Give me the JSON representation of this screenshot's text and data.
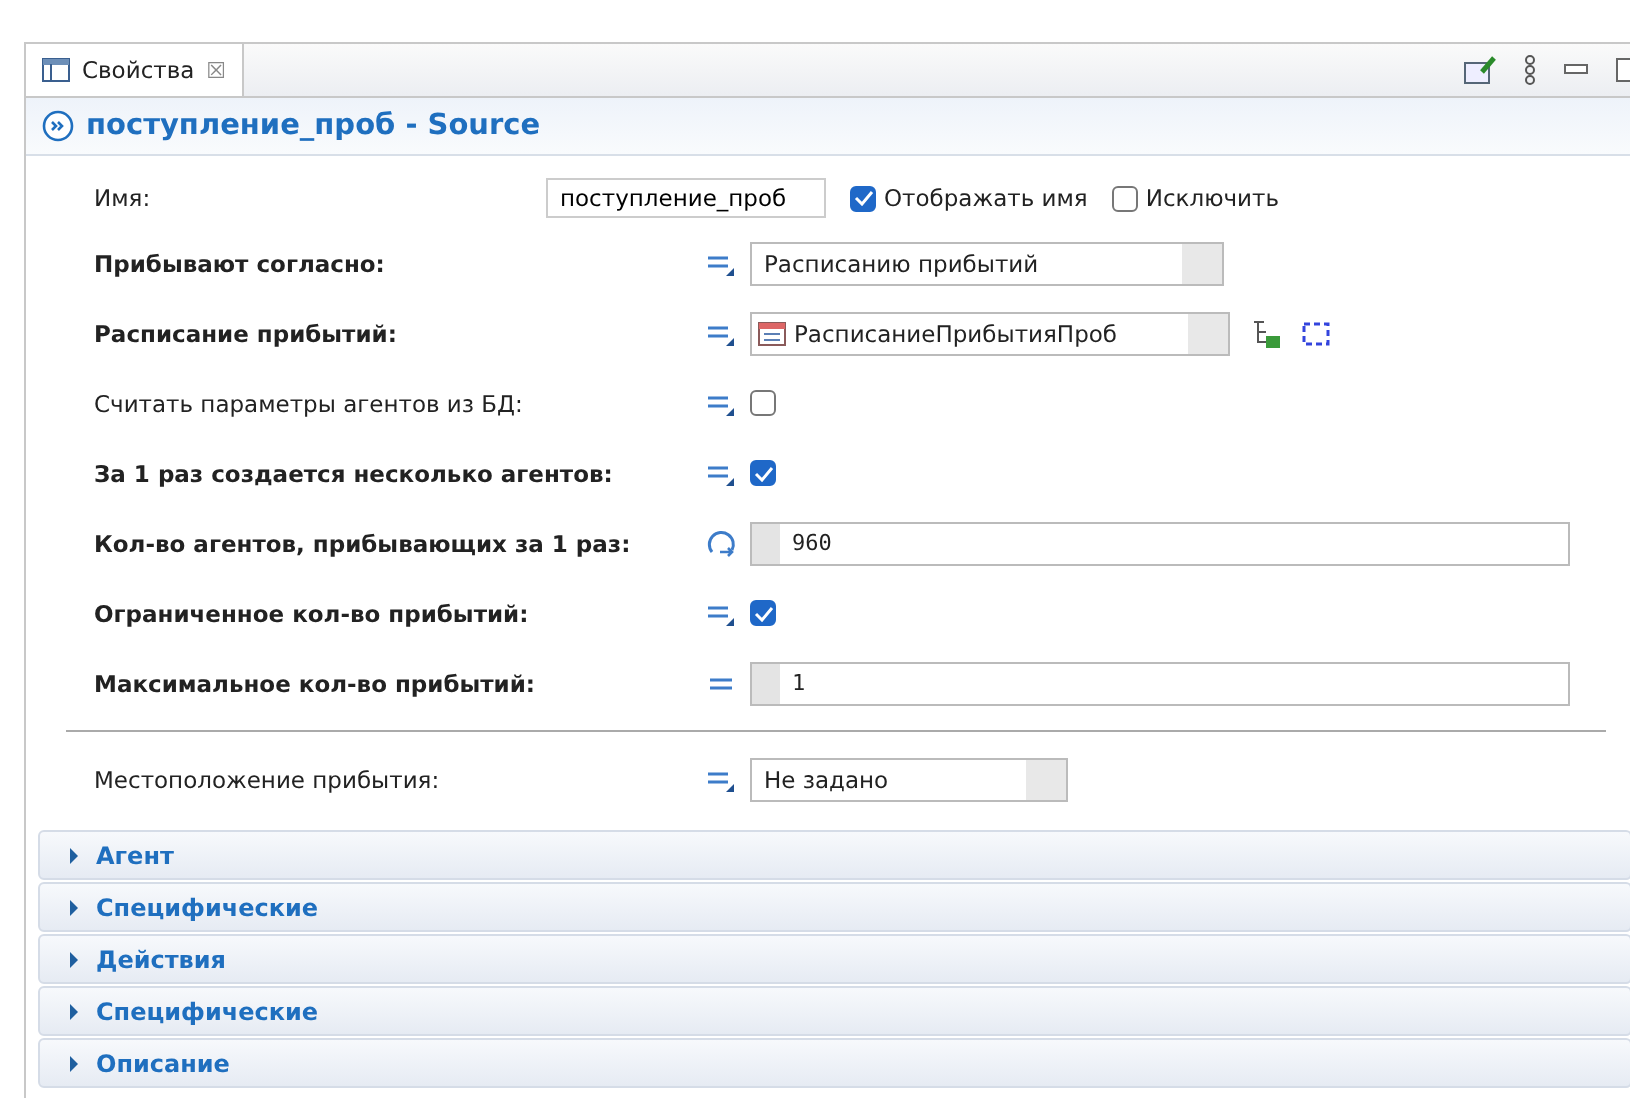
{
  "tab": {
    "label": "Свойства",
    "close": "☒"
  },
  "header": {
    "title": "поступление_проб - Source"
  },
  "name_row": {
    "label": "Имя:",
    "value": "поступление_проб",
    "options": [
      {
        "label": "Отображать имя",
        "checked": true
      },
      {
        "label": "Исключить",
        "checked": false
      }
    ]
  },
  "rows": [
    {
      "kind": "dropdown",
      "label": "Прибывают согласно:",
      "bold": true,
      "editor": {
        "kind": "static"
      },
      "value": "Расписанию прибытий"
    },
    {
      "kind": "reference",
      "label": "Расписание прибытий:",
      "bold": true,
      "editor": {
        "kind": "static"
      },
      "value": "РасписаниеПрибытияПроб"
    },
    {
      "kind": "checkbox",
      "label": "Считать параметры агентов из БД:",
      "bold": false,
      "editor": {
        "kind": "static"
      },
      "checked": false
    },
    {
      "kind": "checkbox",
      "label": "За 1 раз создается несколько агентов:",
      "bold": true,
      "editor": {
        "kind": "static"
      },
      "checked": true
    },
    {
      "kind": "code",
      "label": "Кол-во агентов, прибывающих за 1 раз:",
      "bold": true,
      "editor": {
        "kind": "dynamic"
      },
      "value": "960"
    },
    {
      "kind": "checkbox",
      "label": "Ограниченное кол-во прибытий:",
      "bold": true,
      "editor": {
        "kind": "static"
      },
      "checked": true
    },
    {
      "kind": "code",
      "label": "Максимальное кол-во прибытий:",
      "bold": true,
      "editor": {
        "kind": "plain"
      },
      "value": "1"
    },
    {
      "kind": "divider"
    },
    {
      "kind": "dropdown",
      "label": "Местоположение прибытия:",
      "bold": false,
      "editor": {
        "kind": "static"
      },
      "value": "Не задано"
    }
  ],
  "sections": [
    {
      "label": "Агент",
      "expanded": false
    },
    {
      "label": "Специфические",
      "expanded": false
    },
    {
      "label": "Действия",
      "expanded": false
    },
    {
      "label": "Специфические",
      "expanded": false
    },
    {
      "label": "Описание",
      "expanded": false
    }
  ]
}
